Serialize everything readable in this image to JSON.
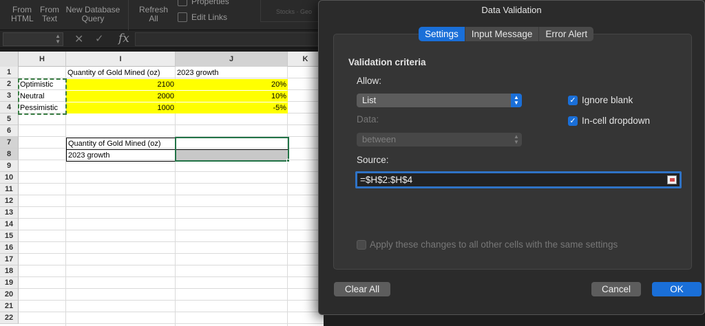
{
  "ribbon": {
    "from_html": [
      "From",
      "HTML"
    ],
    "from_text": [
      "From",
      "Text"
    ],
    "new_db_query": [
      "New Database",
      "Query"
    ],
    "refresh_all": [
      "Refresh",
      "All"
    ],
    "properties": "Properties",
    "edit_links": "Edit Links",
    "stocks": "Stocks · Geo"
  },
  "formula_bar": {
    "fx": "fx",
    "cancel_glyph": "✕",
    "enter_glyph": "✓"
  },
  "sheet": {
    "columns": [
      "H",
      "I",
      "J",
      "K"
    ],
    "rows": [
      "1",
      "2",
      "3",
      "4",
      "5",
      "6",
      "7",
      "8",
      "9",
      "10",
      "11",
      "12",
      "13",
      "14",
      "15",
      "16",
      "17",
      "18",
      "19",
      "20",
      "21",
      "22"
    ],
    "cells": {
      "i1": "Quantity of Gold Mined (oz)",
      "j1": "2023 growth",
      "h2": "Optimistic",
      "i2": "2100",
      "j2": "20%",
      "h3": "Neutral",
      "i3": "2000",
      "j3": "10%",
      "h4": "Pessimistic",
      "i4": "1000",
      "j4": "-5%",
      "i7": "Quantity of Gold Mined (oz)",
      "i8": "2023 growth"
    },
    "highlight_color": "#ffff00"
  },
  "dialog": {
    "title": "Data Validation",
    "tabs": [
      "Settings",
      "Input Message",
      "Error Alert"
    ],
    "active_tab": "Settings",
    "section_title": "Validation criteria",
    "allow_label": "Allow:",
    "allow_value": "List",
    "data_label": "Data:",
    "data_value": "between",
    "ignore_blank": "Ignore blank",
    "ignore_blank_checked": true,
    "in_cell_dropdown": "In-cell dropdown",
    "in_cell_dropdown_checked": true,
    "source_label": "Source:",
    "source_value": "=$H$2:$H$4",
    "apply_all": "Apply these changes to all other cells with the same settings",
    "apply_all_checked": false,
    "clear_all": "Clear All",
    "cancel": "Cancel",
    "ok": "OK",
    "accent_color": "#1a6fd8"
  }
}
